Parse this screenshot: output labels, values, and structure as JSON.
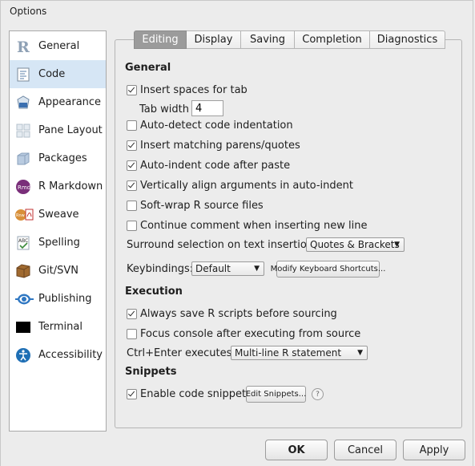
{
  "window": {
    "title": "Options"
  },
  "sidebar": {
    "items": [
      {
        "label": "General",
        "icon": "r-logo-icon"
      },
      {
        "label": "Code",
        "icon": "code-document-icon",
        "selected": true
      },
      {
        "label": "Appearance",
        "icon": "paint-bucket-icon"
      },
      {
        "label": "Pane Layout",
        "icon": "pane-layout-icon"
      },
      {
        "label": "Packages",
        "icon": "package-box-icon"
      },
      {
        "label": "R Markdown",
        "icon": "rmd-icon"
      },
      {
        "label": "Sweave",
        "icon": "sweave-pdf-icon"
      },
      {
        "label": "Spelling",
        "icon": "abc-check-icon"
      },
      {
        "label": "Git/SVN",
        "icon": "git-box-icon"
      },
      {
        "label": "Publishing",
        "icon": "publishing-icon"
      },
      {
        "label": "Terminal",
        "icon": "terminal-icon"
      },
      {
        "label": "Accessibility",
        "icon": "accessibility-icon"
      }
    ]
  },
  "tabs": [
    {
      "label": "Editing",
      "active": true
    },
    {
      "label": "Display"
    },
    {
      "label": "Saving"
    },
    {
      "label": "Completion"
    },
    {
      "label": "Diagnostics"
    }
  ],
  "general": {
    "heading": "General",
    "insert_spaces": {
      "label": "Insert spaces for tab",
      "checked": true
    },
    "tab_width": {
      "label": "Tab width",
      "value": "4"
    },
    "auto_detect": {
      "label": "Auto-detect code indentation",
      "checked": false
    },
    "matching_parens": {
      "label": "Insert matching parens/quotes",
      "checked": true
    },
    "auto_indent": {
      "label": "Auto-indent code after paste",
      "checked": true
    },
    "vertical_align": {
      "label": "Vertically align arguments in auto-indent",
      "checked": true
    },
    "soft_wrap": {
      "label": "Soft-wrap R source files",
      "checked": false
    },
    "continue_comment": {
      "label": "Continue comment when inserting new line",
      "checked": false
    },
    "surround": {
      "label": "Surround selection on text insertion:",
      "value": "Quotes & Brackets"
    },
    "keybindings": {
      "label": "Keybindings:",
      "value": "Default",
      "modify_button": "Modify Keyboard Shortcuts..."
    }
  },
  "execution": {
    "heading": "Execution",
    "always_save": {
      "label": "Always save R scripts before sourcing",
      "checked": true
    },
    "focus_console": {
      "label": "Focus console after executing from source",
      "checked": false
    },
    "ctrl_enter": {
      "label": "Ctrl+Enter executes:",
      "value": "Multi-line R statement"
    }
  },
  "snippets": {
    "heading": "Snippets",
    "enable": {
      "label": "Enable code snippets",
      "checked": true
    },
    "edit_button": "Edit Snippets...",
    "help": "?"
  },
  "footer": {
    "ok": "OK",
    "cancel": "Cancel",
    "apply": "Apply"
  },
  "colors": {
    "selected_row": "#d6e6f5",
    "active_tab": "#9b9b9b",
    "accent_blue": "#1f6fb5"
  }
}
